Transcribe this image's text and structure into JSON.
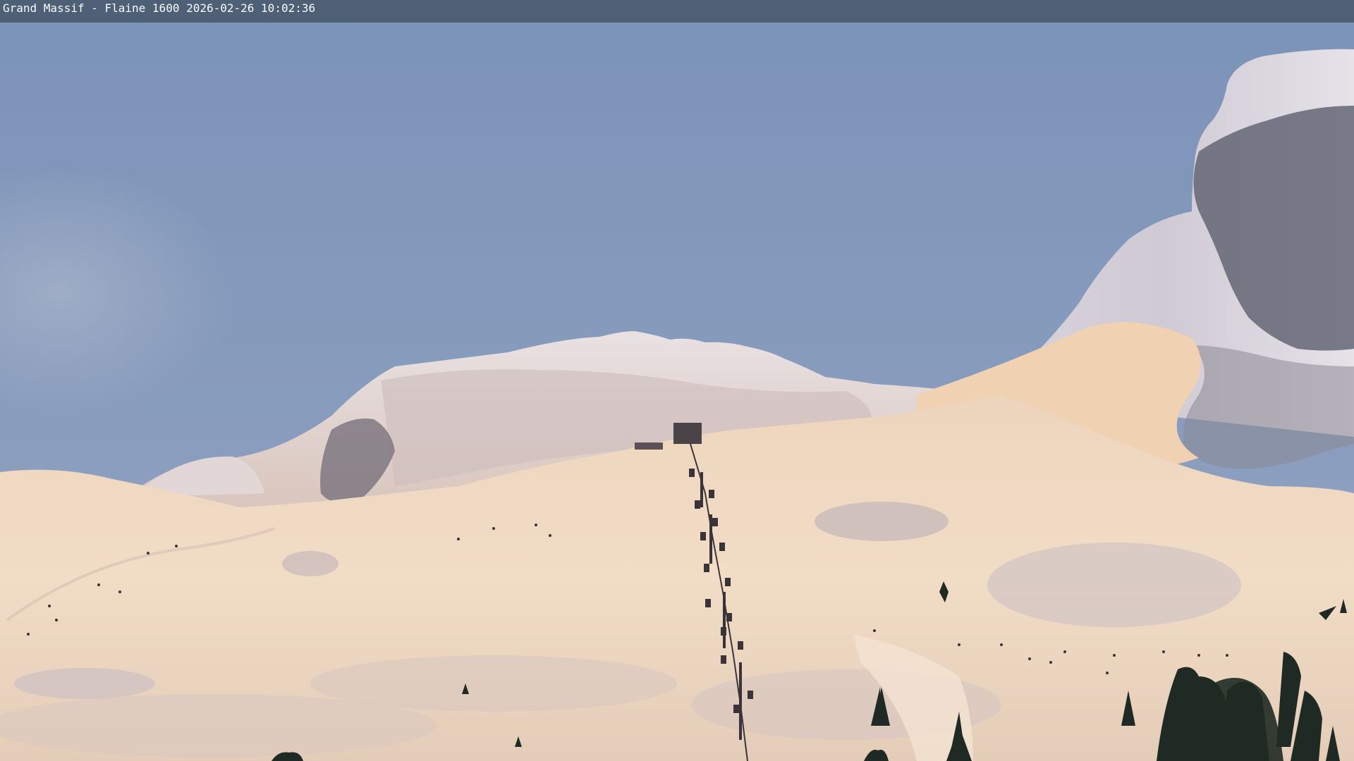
{
  "camera": {
    "overlay": {
      "text": "Grand Massif - Flaine 1600 2026-02-26 10:02:36"
    }
  },
  "scene": {
    "description_kind": "ski resort webcam view",
    "palette": {
      "sky_top": "#7e95b8",
      "sky_bottom": "#93a4c2",
      "snow_lit": "#f2dcc4",
      "snow_warm": "#e8c8a8",
      "snow_shadow": "#c9bcc4",
      "rock_dark": "#4a4a55",
      "tree": "#1f2a24",
      "lift_cable": "#3a3438"
    },
    "elements": [
      "sky",
      "summit-ridge",
      "right-cliff",
      "ski-slopes",
      "chairlift",
      "pine-trees",
      "skiers"
    ]
  }
}
